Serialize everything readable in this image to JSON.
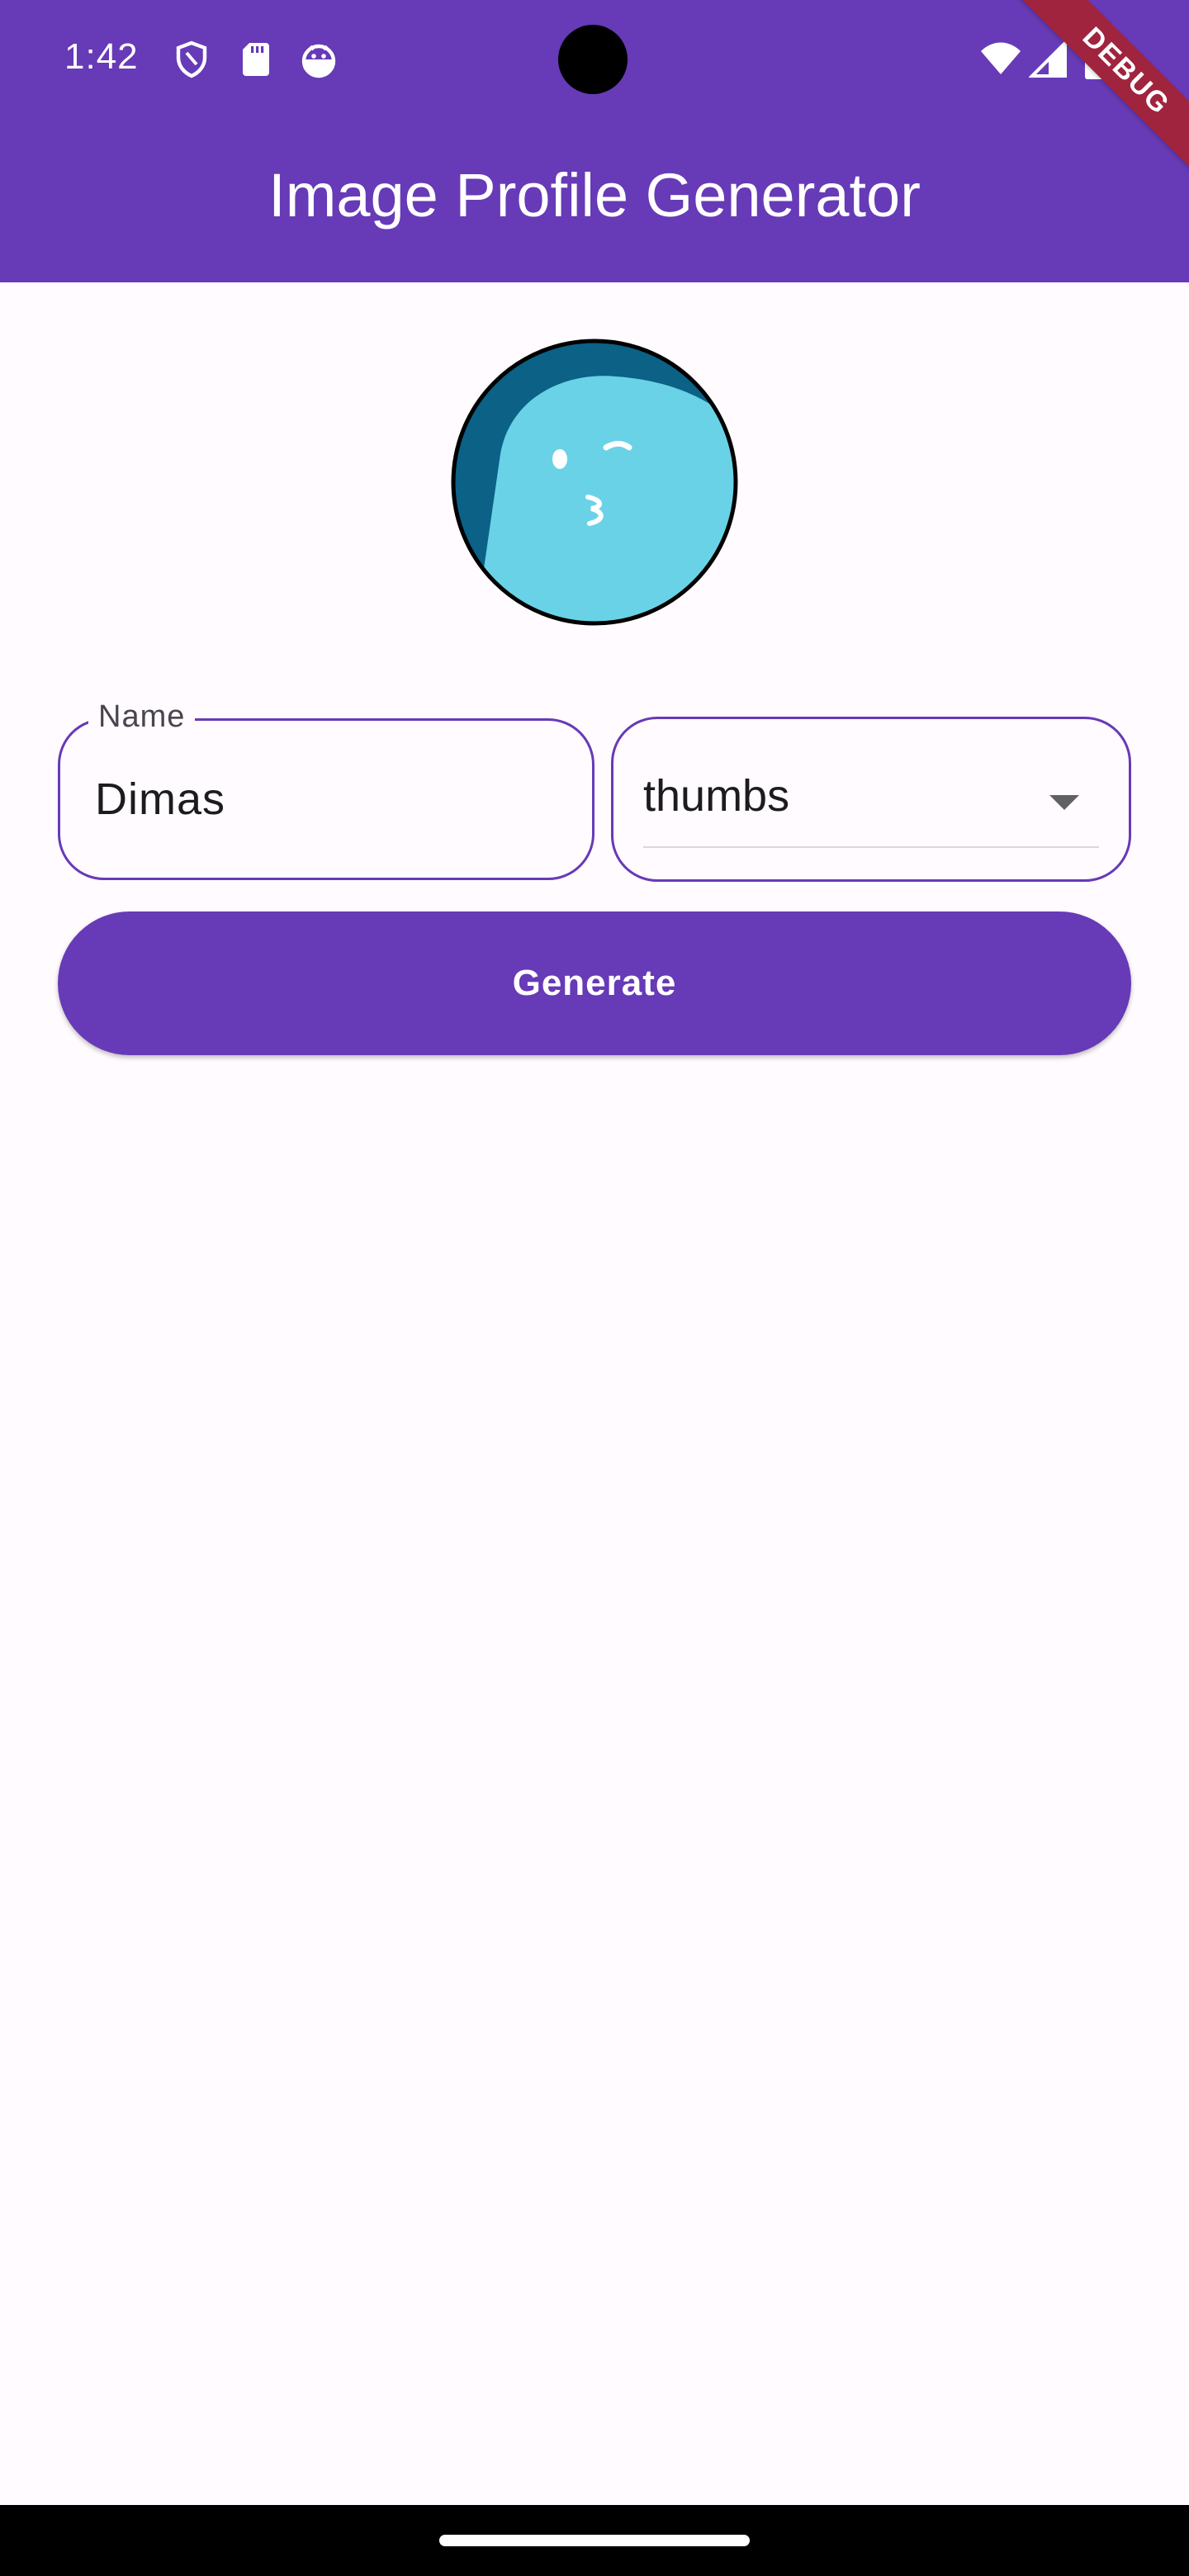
{
  "status_bar": {
    "time": "1:42",
    "left_icons": [
      "shield-icon",
      "sd-card-icon",
      "android-icon"
    ],
    "right_icons": [
      "wifi-icon",
      "cellular-signal-icon",
      "battery-icon"
    ]
  },
  "app_bar": {
    "title": "Image Profile Generator",
    "debug_banner": "DEBUG"
  },
  "avatar": {
    "icon": "thumbs-avatar-icon",
    "colors": {
      "background": "#0b6186",
      "face": "#69d2e7",
      "border": "#000000"
    }
  },
  "form": {
    "name_label": "Name",
    "name_value": "Dimas",
    "style_selected": "thumbs",
    "generate_label": "Generate"
  },
  "colors": {
    "primary": "#673ab7",
    "surface": "#fffbfe",
    "on_surface": "#1c1b1f"
  }
}
